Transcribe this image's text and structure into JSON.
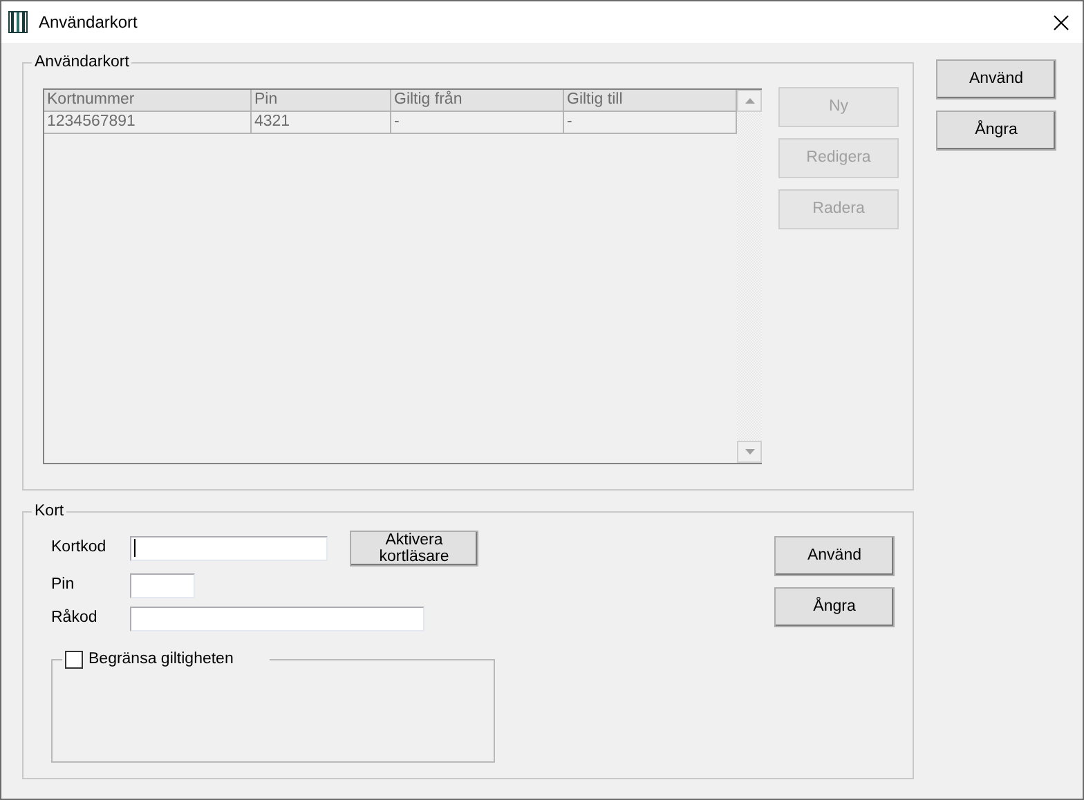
{
  "window": {
    "title": "Användarkort"
  },
  "cards_group": {
    "title": "Användarkort",
    "list_disabled": true,
    "columns": [
      "Kortnummer",
      "Pin",
      "Giltig från",
      "Giltig till"
    ],
    "rows": [
      [
        "1234567891",
        "4321",
        "-",
        "-"
      ]
    ],
    "buttons": [
      {
        "label": "Ny",
        "disabled": true
      },
      {
        "label": "Redigera",
        "disabled": true
      },
      {
        "label": "Radera",
        "disabled": true
      }
    ]
  },
  "dialog_buttons": [
    {
      "label": "Använd",
      "disabled": false
    },
    {
      "label": "Ångra",
      "disabled": false
    }
  ],
  "card_group": {
    "title": "Kort",
    "fields": [
      {
        "label": "Kortkod",
        "focused": true
      },
      {
        "label": "Pin",
        "focused": false
      },
      {
        "label": "Råkod",
        "focused": false
      }
    ],
    "activate_button": "Aktivera kortläsare",
    "limit_validity": {
      "label": "Begränsa giltigheten",
      "checked": false
    },
    "buttons": [
      {
        "label": "Använd",
        "disabled": false
      },
      {
        "label": "Ångra",
        "disabled": false
      }
    ]
  }
}
